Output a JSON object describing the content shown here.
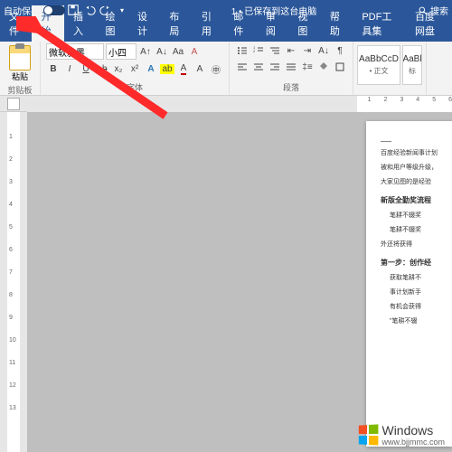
{
  "titlebar": {
    "autosave_label": "自动保存",
    "doc_status": "1 • 已保存到这台电脑",
    "search_placeholder": "搜索"
  },
  "tabs": [
    "文件",
    "开始",
    "插入",
    "绘图",
    "设计",
    "布局",
    "引用",
    "邮件",
    "审阅",
    "视图",
    "帮助",
    "PDF工具集",
    "百度网盘"
  ],
  "active_tab": 1,
  "ribbon": {
    "clipboard": {
      "paste": "粘贴",
      "label": "剪贴板"
    },
    "font": {
      "name": "微软雅黑",
      "size": "小四",
      "label": "字体",
      "buttons_row1": [
        "A↑",
        "A↓",
        "Aa",
        "A"
      ],
      "bold": "B",
      "italic": "I",
      "underline": "U",
      "strike": "ab"
    },
    "paragraph": {
      "label": "段落"
    },
    "styles": [
      {
        "preview": "AaBbCcD",
        "name": "• 正文"
      },
      {
        "preview": "AaBl",
        "name": "标"
      }
    ]
  },
  "ruler": {
    "h": [
      "1",
      "2",
      "3",
      "4",
      "5",
      "6"
    ],
    "v": [
      "1",
      "2",
      "3",
      "4",
      "5",
      "6",
      "7",
      "8",
      "9",
      "10",
      "11",
      "12",
      "13"
    ]
  },
  "document": {
    "lines": [
      "百度经验新闻事计划",
      "被和用户等级升级，",
      "大家见图的是经验"
    ],
    "heading1": "新版全勤奖流程",
    "sub1": [
      "笔耕不辍奖",
      "笔耕不辍奖",
      "外还将获得"
    ],
    "heading2": "第一步：创作经",
    "sub2": [
      "获取笔耕不",
      "事计划新手",
      "有机会获得",
      "\"笔耕不辍"
    ]
  },
  "watermark": {
    "brand": "Windows",
    "site": "www.bjjmmc.com"
  },
  "colors": {
    "accent": "#2b579a",
    "arrow": "#ff2a2a"
  }
}
